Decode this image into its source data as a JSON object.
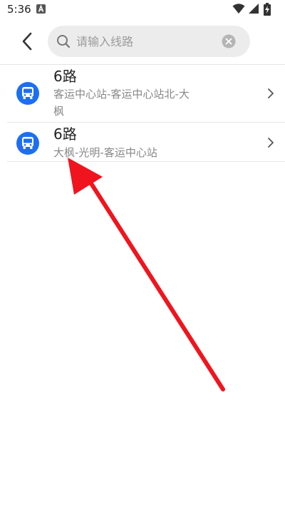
{
  "status_bar": {
    "time": "5:36",
    "icons": [
      "notification-a-icon",
      "wifi-icon",
      "signal-icon",
      "battery-charging-icon"
    ]
  },
  "header": {
    "back_icon": "chevron-left-icon",
    "search": {
      "value": "",
      "placeholder": "请输入线路",
      "icon": "search-icon",
      "clear_icon": "clear-circle-icon"
    }
  },
  "results": [
    {
      "name": "6路",
      "description": "客运中心站-客运中心站北-大枫",
      "icon": "bus-icon"
    },
    {
      "name": "6路",
      "description": "大枫-光明-客运中心站",
      "icon": "bus-icon"
    }
  ],
  "colors": {
    "accent": "#1d6ff2",
    "annotation_arrow": "#f0141e",
    "search_bg": "#ececec"
  }
}
